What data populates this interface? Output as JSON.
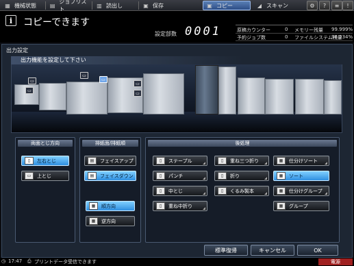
{
  "tabs": [
    {
      "label": "機械状態",
      "icon": "machine-status-icon"
    },
    {
      "label": "ジョブリスト",
      "icon": "job-list-icon"
    },
    {
      "label": "読出し",
      "icon": "recall-icon"
    },
    {
      "label": "保存",
      "icon": "store-icon"
    },
    {
      "label": "コピー",
      "icon": "copy-icon",
      "active": true
    },
    {
      "label": "スキャン",
      "icon": "scan-icon"
    }
  ],
  "status": {
    "message": "コピーできます",
    "copies_label": "設定部数",
    "copies_value": "0001"
  },
  "meters": {
    "rows": [
      {
        "label": "原稿カウンター",
        "value": "0",
        "label2": "メモリー残量",
        "value2": "99.999%"
      },
      {
        "label": "予約ジョブ数",
        "value": "0",
        "label2": "ファイルシステム残量",
        "value2": "98.234%"
      }
    ]
  },
  "panel": {
    "title": "出力設定",
    "prompt": "出力機能を設定して下さい"
  },
  "binding": {
    "title": "両面とじ方向",
    "options": [
      {
        "label": "左右とじ",
        "selected": true
      },
      {
        "label": "上とじ",
        "selected": false
      }
    ]
  },
  "output_face": {
    "title": "排紙面/排紙順",
    "face_options": [
      {
        "label": "フェイスアップ",
        "selected": false
      },
      {
        "label": "フェイスダウン",
        "selected": true
      }
    ],
    "order_options": [
      {
        "label": "順方向",
        "selected": true
      },
      {
        "label": "逆方向",
        "selected": false
      }
    ]
  },
  "finishing": {
    "title": "後処理",
    "col1": [
      "ステープル",
      "パンチ",
      "中とじ",
      "重ね中折り"
    ],
    "col2": [
      "重ね三つ折り",
      "折り",
      "くるみ製本"
    ],
    "col3": [
      "仕分けソート",
      "ソート",
      "仕分けグループ",
      "グループ"
    ],
    "selected": "ソート"
  },
  "footer": {
    "reset": "標準復帰",
    "cancel": "キャンセル",
    "ok": "OK"
  },
  "bottom": {
    "time": "17:47",
    "message": "プリントデータ受信できます",
    "badge": "電源"
  },
  "colors": {
    "accent": "#2f8fe0",
    "selected_tab": "#2d4e86",
    "badge": "#a02020"
  }
}
